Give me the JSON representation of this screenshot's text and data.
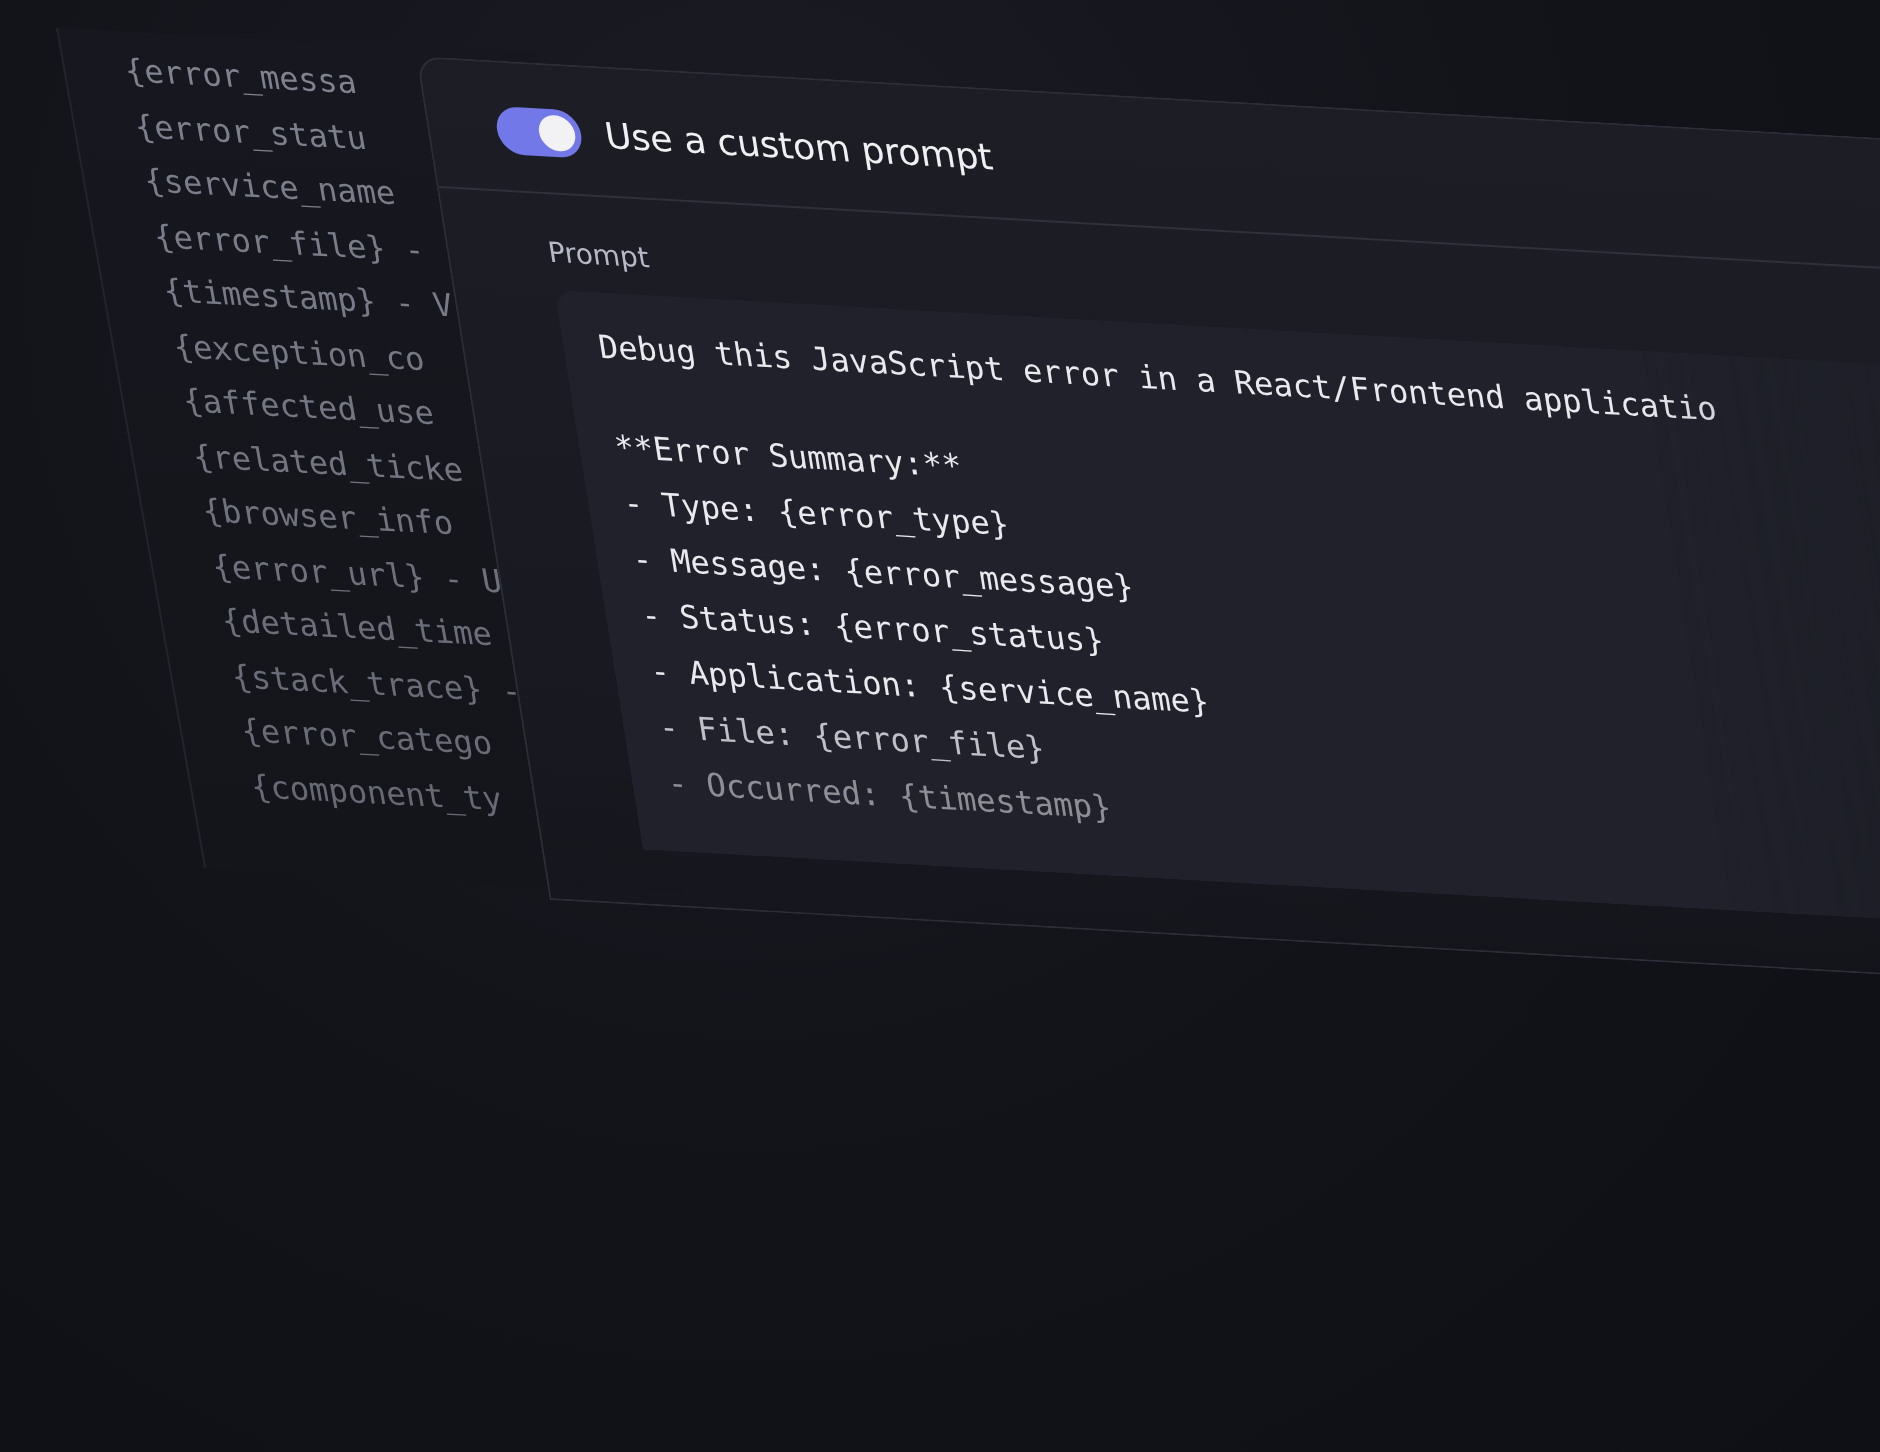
{
  "background_panel": {
    "lines": [
      "{error_messa",
      "{error_statu",
      "{service_name",
      "{error_file} -",
      "{timestamp} - V",
      "{exception_co",
      "{affected_use",
      "{related_ticke",
      "{browser_info",
      "{error_url} - U",
      "{detailed_time",
      "{stack_trace} -",
      "{error_catego",
      "{component_ty"
    ]
  },
  "panel": {
    "toggle": {
      "label": "Use a custom prompt",
      "on": true
    },
    "prompt_label": "Prompt",
    "prompt_blocks": [
      [
        "Debug this JavaScript error in a React/Frontend applicatio"
      ],
      [
        "**Error Summary:**",
        "- Type: {error_type}",
        "- Message: {error_message}",
        "- Status: {error_status}",
        "- Application: {service_name}",
        "- File: {error_file}",
        "- Occurred: {timestamp}"
      ]
    ]
  }
}
